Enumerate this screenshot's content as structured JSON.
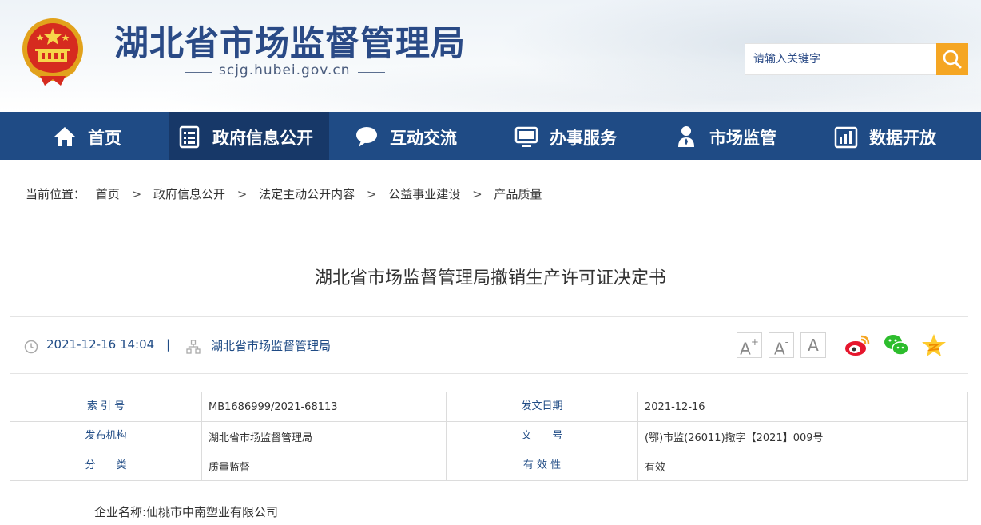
{
  "header": {
    "site_title": "湖北省市场监督管理局",
    "site_url": "scjg.hubei.gov.cn",
    "search_placeholder": "请输入关键字"
  },
  "nav": {
    "items": [
      {
        "label": "首页",
        "icon": "home-icon"
      },
      {
        "label": "政府信息公开",
        "icon": "document-list-icon",
        "active": true
      },
      {
        "label": "互动交流",
        "icon": "chat-bubble-icon"
      },
      {
        "label": "办事服务",
        "icon": "monitor-icon"
      },
      {
        "label": "市场监管",
        "icon": "inspector-icon"
      },
      {
        "label": "数据开放",
        "icon": "bar-chart-icon"
      }
    ]
  },
  "breadcrumb": {
    "prefix": "当前位置：",
    "items": [
      "首页",
      "政府信息公开",
      "法定主动公开内容",
      "公益事业建设",
      "产品质量"
    ],
    "separator": ">"
  },
  "article": {
    "title": "湖北省市场监督管理局撤销生产许可证决定书",
    "datetime": "2021-12-16 14:04",
    "divider": "|",
    "source": "湖北省市场监督管理局",
    "font_controls": [
      "A+",
      "A-",
      "A"
    ],
    "share": [
      "weibo-icon",
      "wechat-icon",
      "qzone-icon"
    ]
  },
  "info_table": {
    "rows": [
      {
        "k1": "索 引 号",
        "v1": "MB1686999/2021-68113",
        "k2": "发文日期",
        "v2": "2021-12-16"
      },
      {
        "k1": "发布机构",
        "v1": "湖北省市场监督管理局",
        "k2": "文　　号",
        "v2": "(鄂)市监(26011)撤字【2021】009号"
      },
      {
        "k1": "分　　类",
        "v1": "质量监督",
        "k2": "有 效 性",
        "v2": "有效"
      }
    ]
  },
  "body": {
    "first_line": "企业名称:仙桃市中南塑业有限公司"
  },
  "colors": {
    "nav_bg": "#1f4b85",
    "nav_active": "#173868",
    "title_blue": "#2a4a86",
    "search_orange": "#f5a623"
  }
}
